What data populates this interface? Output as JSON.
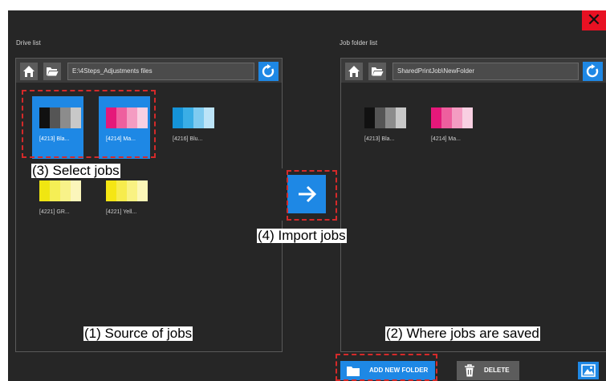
{
  "window": {
    "close_glyph": "✕"
  },
  "drive": {
    "title": "Drive list",
    "path": "E:\\4Steps_Adjustments files",
    "jobs": [
      {
        "label": "[4213] Bla...",
        "colors": [
          "#111111",
          "#555555",
          "#8c8c8c",
          "#c8c8c8"
        ]
      },
      {
        "label": "[4214] Ma...",
        "colors": [
          "#e5187a",
          "#ee5f9e",
          "#f49cc2",
          "#f9d0e2"
        ]
      },
      {
        "label": "[4216] Blu...",
        "colors": [
          "#1593d8",
          "#3aaee6",
          "#7fcbf0",
          "#bce4f8"
        ]
      },
      {
        "label": "[4221] GR...",
        "colors": [
          "#f0e612",
          "#f5ee55",
          "#f8f289",
          "#fbf6bb"
        ]
      },
      {
        "label": "[4221] Yell...",
        "colors": [
          "#f5e614",
          "#f7ec4d",
          "#f9f282",
          "#fcf7b7"
        ]
      }
    ]
  },
  "folder": {
    "title": "Job folder list",
    "path": "SharedPrintJob\\NewFolder",
    "jobs": [
      {
        "label": "[4213] Bla...",
        "colors": [
          "#111111",
          "#555555",
          "#8c8c8c",
          "#c8c8c8"
        ]
      },
      {
        "label": "[4214] Ma...",
        "colors": [
          "#e5187a",
          "#ee5f9e",
          "#f49cc2",
          "#f9d0e2"
        ]
      }
    ]
  },
  "buttons": {
    "add_new_folder": "ADD NEW FOLDER",
    "delete": "DELETE"
  },
  "annotations": {
    "select_jobs": "(3) Select jobs",
    "import_jobs": "(4) Import jobs",
    "source": "(1) Source of jobs",
    "saved": "(2) Where jobs are saved"
  },
  "colors": {
    "accent": "#1e88e5",
    "close": "#e81123",
    "annotation_dash": "#d52a2a"
  }
}
